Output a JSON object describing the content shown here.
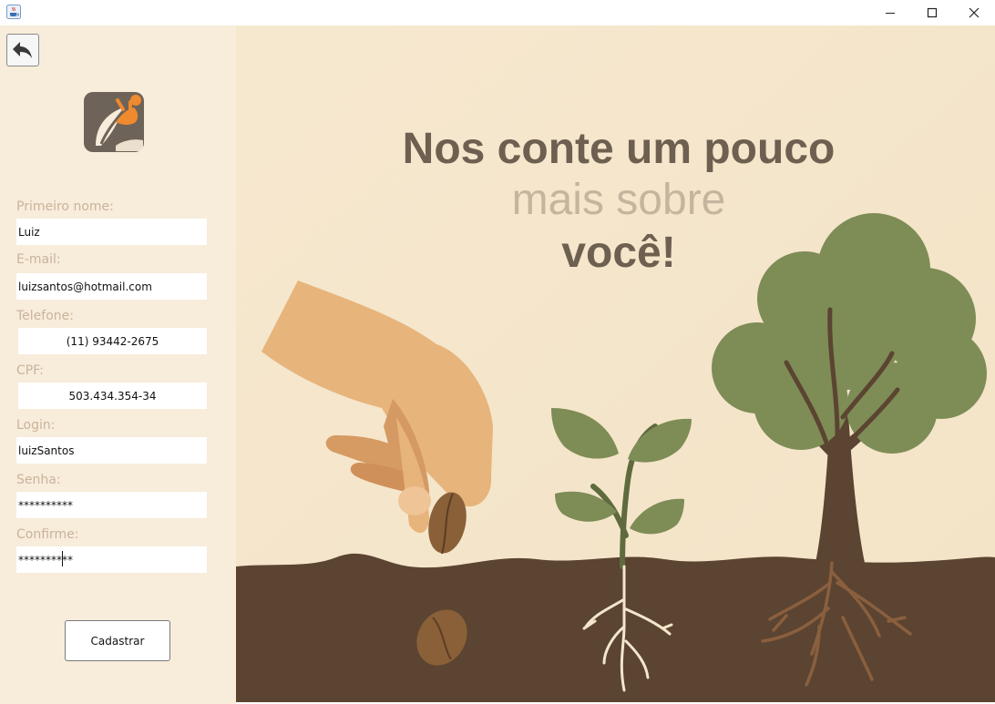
{
  "window": {
    "icon": "java-cup-icon",
    "controls": [
      "minimize-icon",
      "maximize-icon",
      "close-icon"
    ]
  },
  "form": {
    "back_icon": "back-arrow-icon",
    "logo_icon": "leaf-person-logo",
    "fields": [
      {
        "label": "Primeiro nome:",
        "value": "Luiz"
      },
      {
        "label": "E-mail:",
        "value": "luizsantos@hotmail.com"
      },
      {
        "label": "Telefone:",
        "value": "(11) 93442-2675"
      },
      {
        "label": "CPF:",
        "value": "503.434.354-34"
      },
      {
        "label": "Login:",
        "value": "luizSantos"
      },
      {
        "label": "Senha:",
        "value": "**********"
      },
      {
        "label": "Confirme:",
        "value": "**********"
      }
    ],
    "submit_label": "Cadastrar"
  },
  "hero": {
    "line1": "Nos conte um pouco",
    "line2": "mais sobre",
    "line3": "você!"
  },
  "colors": {
    "panel": "#f8ecdb",
    "label": "#c9b49a",
    "heading_dark": "#6e6050",
    "heading_light": "#c6b59e",
    "soil": "#5b4431",
    "leaf": "#7e8c56"
  }
}
